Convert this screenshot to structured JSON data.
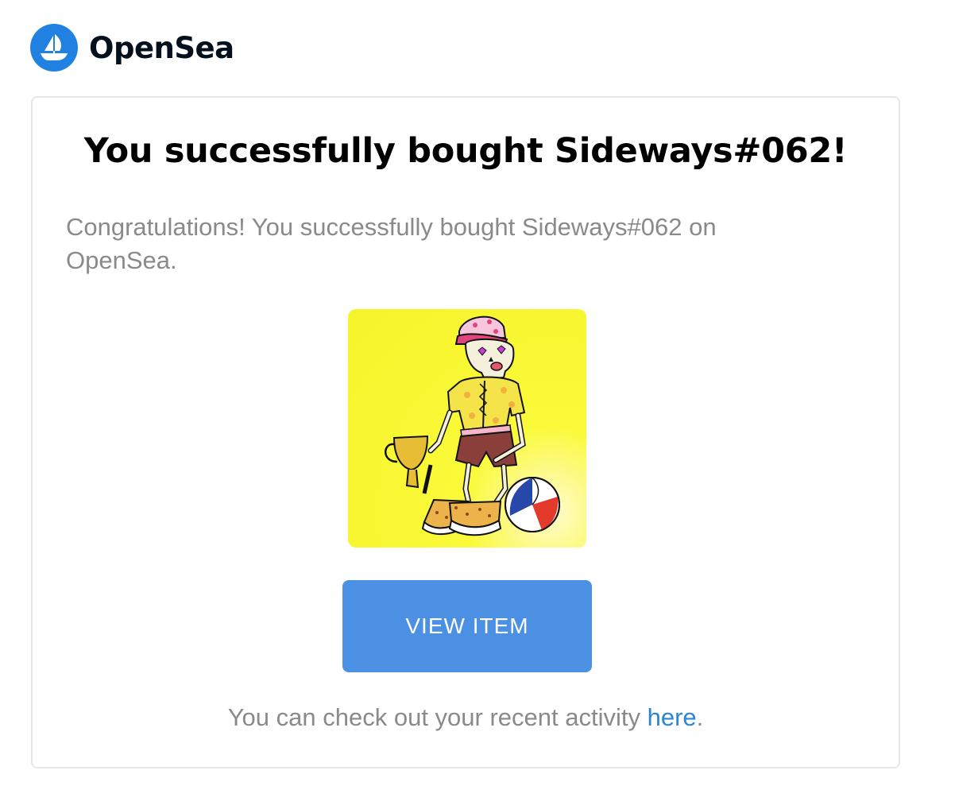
{
  "brand": {
    "name": "OpenSea",
    "logo_icon": "sailboat-icon",
    "logo_color": "#2081e2"
  },
  "card": {
    "title": "You successfully bought Sideways#062!",
    "message": "Congratulations! You successfully bought Sideways#062 on OpenSea.",
    "image_alt": "Sideways#062",
    "button_label": "VIEW ITEM",
    "footer_prefix": "You can check out your recent activity ",
    "footer_link": "here",
    "footer_suffix": "."
  },
  "colors": {
    "button": "#4b90e2",
    "link": "#2c86d6",
    "muted_text": "#8a8a8a"
  }
}
